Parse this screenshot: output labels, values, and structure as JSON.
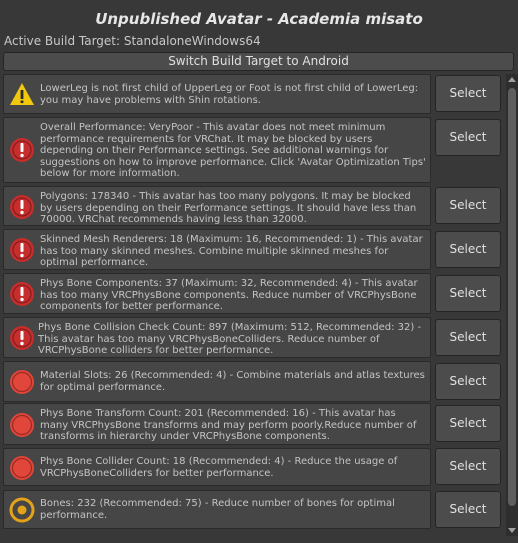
{
  "window": {
    "title": "Unpublished Avatar - Academia misato",
    "build_target": "Active Build Target: StandaloneWindows64",
    "switch_label": "Switch Build Target to Android"
  },
  "colors": {
    "warning": "#f2c80f",
    "error_dark": "#c62d2d",
    "error_red": "#e0463a",
    "info_yellow": "#e2a31a"
  },
  "messages": [
    {
      "icon": "warning-icon",
      "severity": "warning",
      "text": "LowerLeg is not first child of UpperLeg or Foot is not first child of LowerLeg: you may have problems with Shin rotations.",
      "select": "Select"
    },
    {
      "icon": "error-exclamation-icon",
      "severity": "very-poor",
      "text": "Overall Performance: VeryPoor - This avatar does not meet minimum performance requirements for VRChat. It may be blocked by users depending on their Performance settings. See additional warnings for suggestions on how to improve performance. Click 'Avatar Optimization Tips' below for more information.",
      "select": "Select"
    },
    {
      "icon": "error-exclamation-icon",
      "severity": "very-poor",
      "text": "Polygons: 178340 - This avatar has too many polygons. It may be blocked by users depending on their Performance settings. It should have less than 70000. VRChat recommends having less than 32000.",
      "select": "Select"
    },
    {
      "icon": "error-exclamation-icon",
      "severity": "very-poor",
      "text": "Skinned Mesh Renderers: 18 (Maximum: 16, Recommended: 1) - This avatar has too many skinned meshes. Combine multiple skinned meshes for optimal performance.",
      "select": "Select"
    },
    {
      "icon": "error-exclamation-icon",
      "severity": "very-poor",
      "text": "Phys Bone Components: 37 (Maximum: 32, Recommended: 4) - This avatar has too many VRCPhysBone components. Reduce number of VRCPhysBone components for better performance.",
      "select": "Select"
    },
    {
      "icon": "error-exclamation-icon",
      "severity": "very-poor",
      "text": "Phys Bone Collision Check Count: 897 (Maximum: 512, Recommended: 32) - This avatar has too many VRCPhysBoneColliders. Reduce number of VRCPhysBone colliders for better performance.",
      "select": "Select"
    },
    {
      "icon": "red-dot-icon",
      "severity": "poor",
      "text": "Material Slots: 26 (Recommended: 4) - Combine materials and atlas textures for optimal performance.",
      "select": "Select"
    },
    {
      "icon": "red-dot-icon",
      "severity": "poor",
      "text": "Phys Bone Transform Count: 201 (Recommended: 16) - This avatar has many VRCPhysBone transforms and may perform poorly.Reduce number of transforms in hierarchy under VRCPhysBone components.",
      "select": "Select"
    },
    {
      "icon": "red-dot-icon",
      "severity": "poor",
      "text": "Phys Bone Collider Count: 18 (Recommended: 4) - Reduce the usage of VRCPhysBoneColliders for better performance.",
      "select": "Select"
    },
    {
      "icon": "yellow-ring-icon",
      "severity": "medium",
      "text": "Bones: 232 (Recommended: 75) - Reduce number of bones for optimal performance.",
      "select": "Select"
    }
  ]
}
